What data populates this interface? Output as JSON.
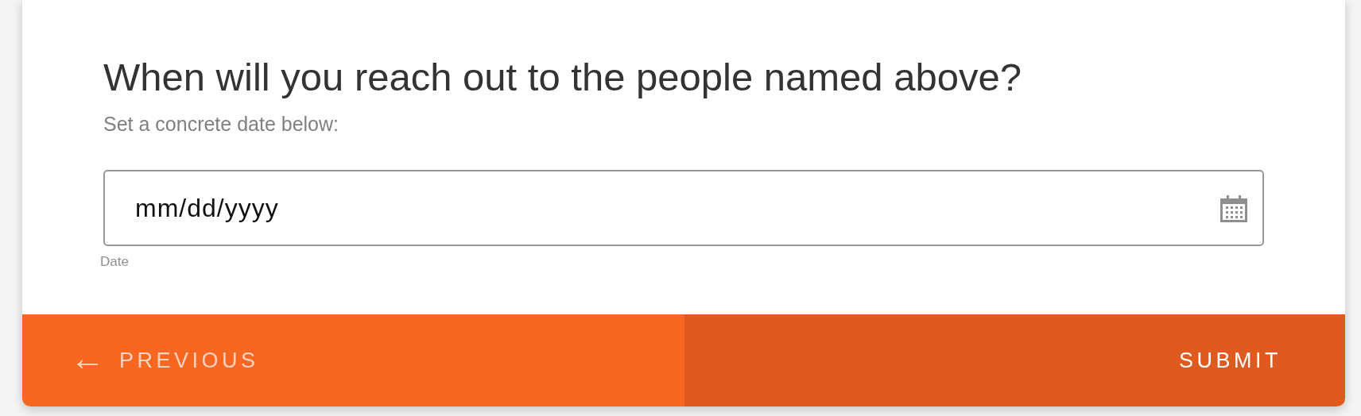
{
  "question": {
    "title": "When will you reach out to the people named above?",
    "subtitle": "Set a concrete date below:"
  },
  "date_field": {
    "placeholder": "mm/dd/yyyy",
    "label": "Date"
  },
  "footer": {
    "previous": {
      "label": "PREVIOUS",
      "arrow": "←"
    },
    "submit": {
      "label": "SUBMIT"
    }
  }
}
